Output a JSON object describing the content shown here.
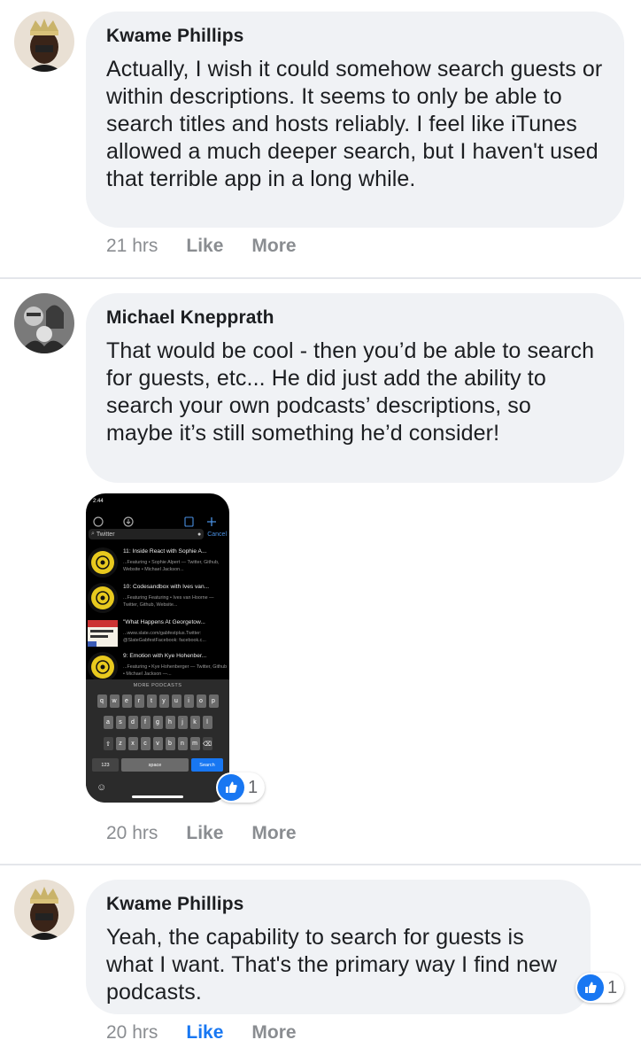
{
  "comments": [
    {
      "author": "Kwame Phillips",
      "text": "Actually, I wish it could somehow search guests or within descriptions. It seems to only be able to search titles and hosts reliably. I feel like iTunes allowed a much deeper search, but I haven't used that terrible app in a long while.",
      "time": "21 hrs",
      "like_label": "Like",
      "more_label": "More"
    },
    {
      "author": "Michael Knepprath",
      "text": "That would be cool - then you’d be able to search for guests, etc... He did just add the ability to search your own podcasts’ descriptions, so maybe it’s still something he’d consider!",
      "time": "20 hrs",
      "like_label": "Like",
      "more_label": "More",
      "reaction_count": "1"
    },
    {
      "author": "Kwame Phillips",
      "text": "Yeah, the capability to search for guests is what I want. That's the primary way I find new podcasts.",
      "time": "20 hrs",
      "like_label": "Like",
      "more_label": "More",
      "reaction_count": "1"
    }
  ],
  "colors": {
    "bubble": "#f0f2f5",
    "meta": "#8a8d91",
    "like_active": "#1877f2"
  },
  "screenshot": {
    "status_time": "2:44",
    "search_value": "Twitter",
    "cancel_label": "Cancel",
    "results": [
      {
        "title": "11: Inside React with Sophie A...",
        "subtitle": "...Featuring • Sophie Alpert — Twitter, Github, Website • Michael Jackson..."
      },
      {
        "title": "10: Codesandbox with Ives van...",
        "subtitle": "...Featuring Featuring • Ives van Hoorne — Twitter, Github, Website..."
      },
      {
        "title": "\"What Happens At Georgetow...",
        "subtitle": "...www.slate.com/gabfestplus.Twitter: @SlateGabfestFacebook: facebook.c..."
      },
      {
        "title": "9: Emotion with Kye Hohenber...",
        "subtitle": "...Featuring • Kye Hohenberger — Twitter, Github • Michael Jackson —..."
      }
    ],
    "more_podcasts_label": "MORE PODCASTS",
    "keyboard": {
      "row1": [
        "q",
        "w",
        "e",
        "r",
        "t",
        "y",
        "u",
        "i",
        "o",
        "p"
      ],
      "row2": [
        "a",
        "s",
        "d",
        "f",
        "g",
        "h",
        "j",
        "k",
        "l"
      ],
      "row3": [
        "z",
        "x",
        "c",
        "v",
        "b",
        "n",
        "m"
      ],
      "numbers_label": "123",
      "space_label": "space",
      "search_label": "Search"
    }
  }
}
